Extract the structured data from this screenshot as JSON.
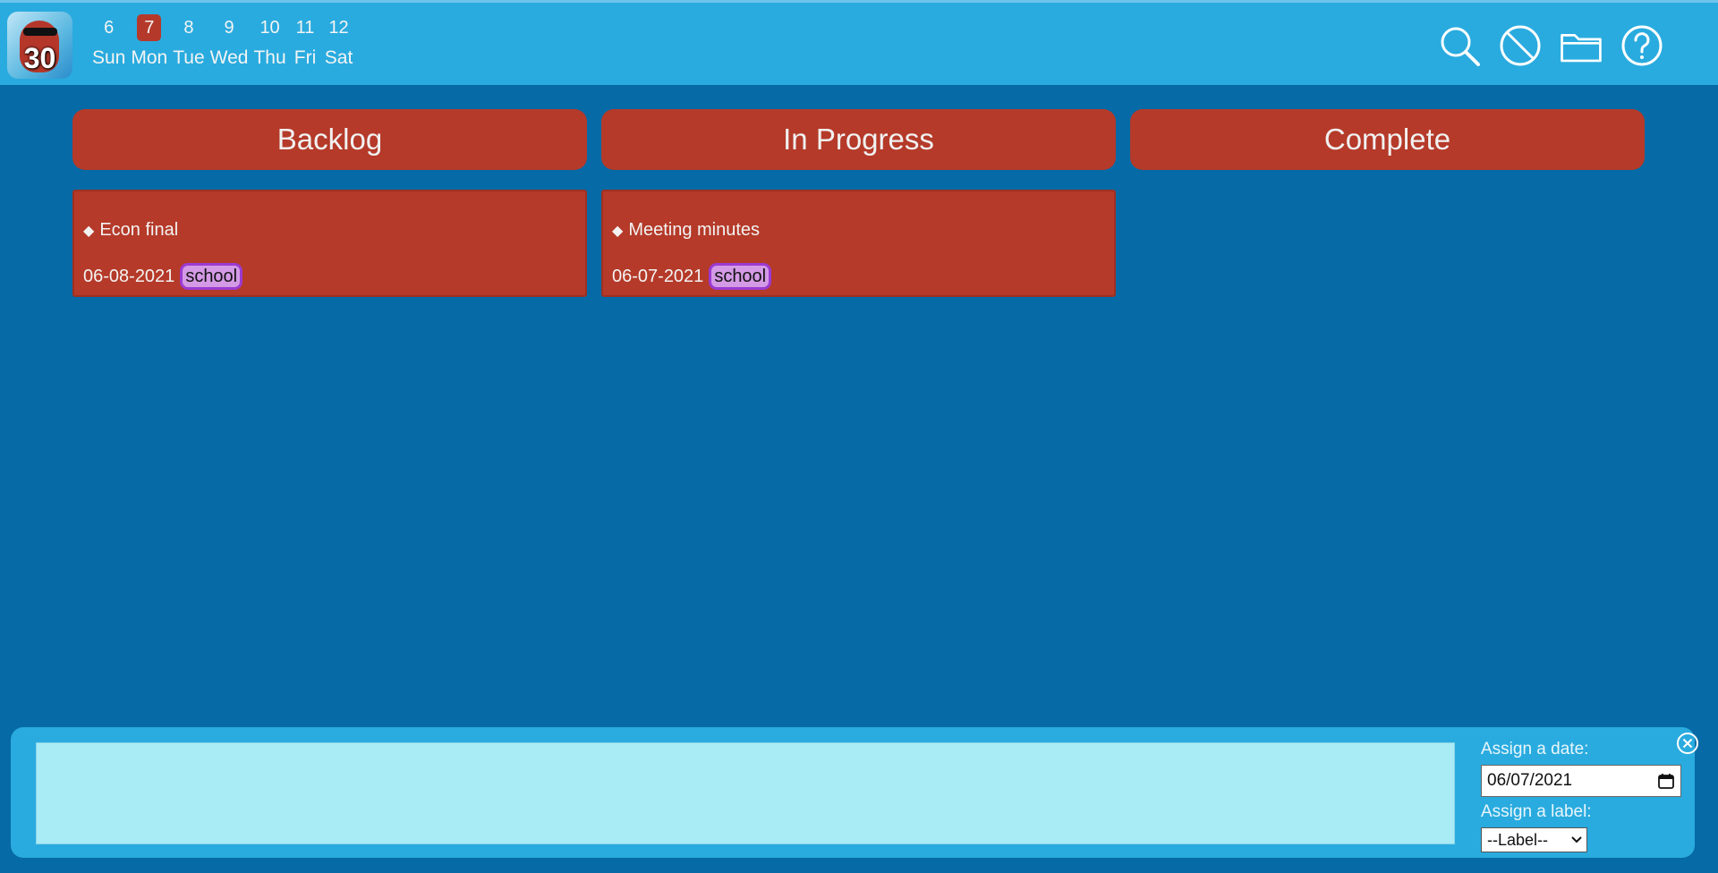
{
  "logo": {
    "number": "30"
  },
  "week": [
    {
      "num": "6",
      "name": "Sun",
      "active": false
    },
    {
      "num": "7",
      "name": "Mon",
      "active": true
    },
    {
      "num": "8",
      "name": "Tue",
      "active": false
    },
    {
      "num": "9",
      "name": "Wed",
      "active": false
    },
    {
      "num": "10",
      "name": "Thu",
      "active": false
    },
    {
      "num": "11",
      "name": "Fri",
      "active": false
    },
    {
      "num": "12",
      "name": "Sat",
      "active": false
    }
  ],
  "toolbar": {
    "icons": [
      "search-icon",
      "block-icon",
      "folder-icon",
      "help-icon"
    ]
  },
  "columns": [
    {
      "title": "Backlog",
      "cards": [
        {
          "title": "Econ final",
          "date": "06-08-2021",
          "tag": "school"
        }
      ]
    },
    {
      "title": "In Progress",
      "cards": [
        {
          "title": "Meeting minutes",
          "date": "06-07-2021",
          "tag": "school"
        }
      ]
    },
    {
      "title": "Complete",
      "cards": []
    }
  ],
  "composer": {
    "textarea_value": "",
    "date_label": "Assign a date:",
    "date_value": "06/07/2021",
    "label_label": "Assign a label:",
    "label_value": "--Label--"
  },
  "colors": {
    "background": "#066aa6",
    "header": "#29abdf",
    "accent": "#b53a29",
    "tag_fill": "#d49ae6",
    "tag_border": "#9b3bd1",
    "textarea": "#a9ecf6"
  }
}
